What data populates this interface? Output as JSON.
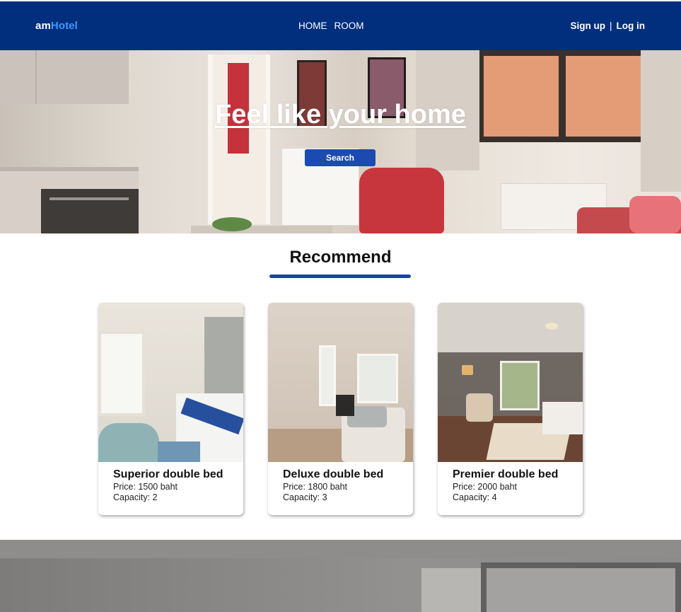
{
  "brand": {
    "part1": "am",
    "part2": "Hotel"
  },
  "nav": {
    "home": "HOME",
    "room": "ROOM"
  },
  "auth": {
    "signup": "Sign up",
    "separator": "|",
    "login": "Log in"
  },
  "hero": {
    "title": "Feel like your home",
    "search_label": "Search"
  },
  "recommend": {
    "title": "Recommend",
    "rooms": [
      {
        "name": "Superior double bed",
        "price": "Price: 1500 baht",
        "capacity": "Capacity: 2"
      },
      {
        "name": "Deluxe double bed",
        "price": "Price: 1800 baht",
        "capacity": "Capacity: 3"
      },
      {
        "name": "Premier double bed",
        "price": "Price: 2000 baht",
        "capacity": "Capacity: 4"
      }
    ]
  },
  "colors": {
    "navbar": "#022e7e",
    "brand_accent": "#3c9bff",
    "button": "#1b4bb0",
    "underline": "#1a45a3"
  }
}
